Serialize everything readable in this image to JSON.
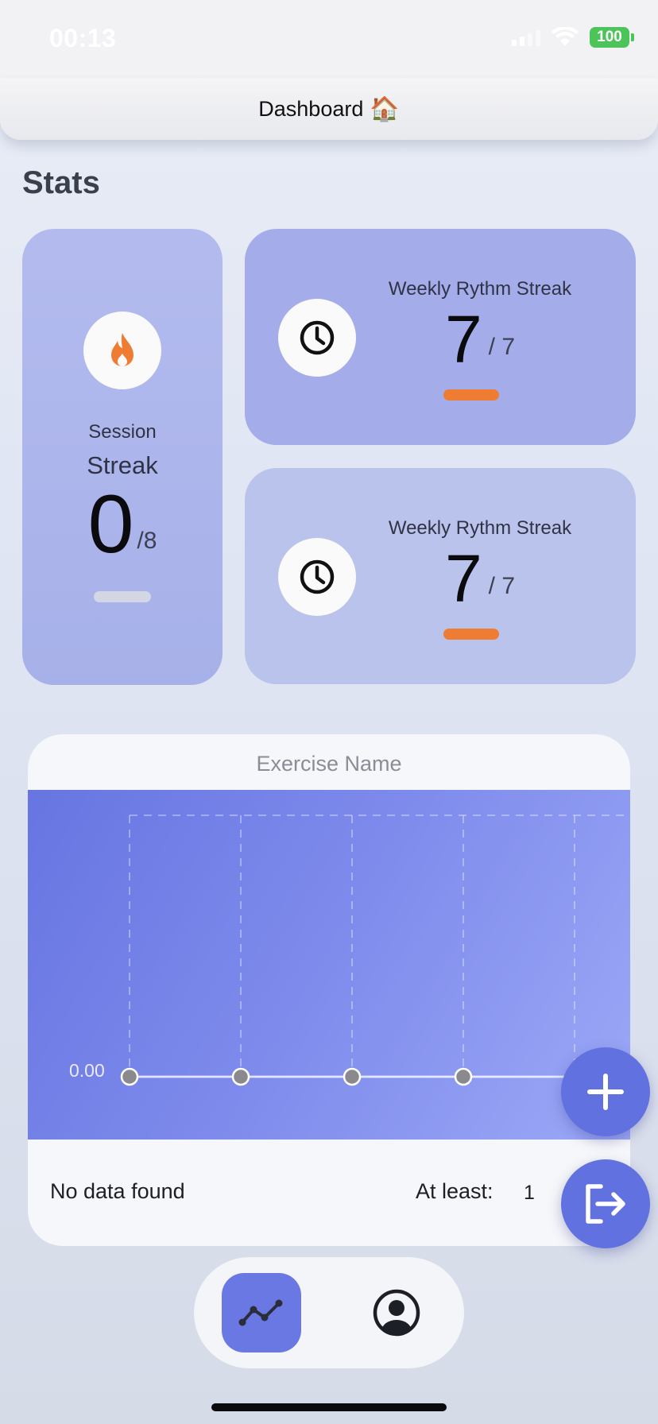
{
  "status_bar": {
    "time": "00:13",
    "battery": "100"
  },
  "header": {
    "title": "Dashboard",
    "emoji": "🏠"
  },
  "stats": {
    "title": "Stats",
    "session": {
      "label_top": "Session",
      "label_bottom": "Streak",
      "value": "0",
      "total": "/8",
      "progress": 0,
      "icon": "flame-icon"
    },
    "weekly_1": {
      "label": "Weekly Rythm Streak",
      "value": "7",
      "total": "/ 7",
      "progress": 1,
      "icon": "clock-icon"
    },
    "weekly_2": {
      "label": "Weekly Rythm Streak",
      "value": "7",
      "total": "/ 7",
      "progress": 1,
      "icon": "clock-icon"
    }
  },
  "chart": {
    "title": "Exercise Name",
    "no_data": "No data found",
    "at_least_label": "At least:",
    "at_least_value": "1"
  },
  "chart_data": {
    "type": "line",
    "title": "Exercise Name",
    "y_tick_labels": [
      "0.00"
    ],
    "values": [
      0,
      0,
      0,
      0,
      0
    ],
    "grid": true
  },
  "colors": {
    "accent": "#6271e0",
    "streak_bar": "#ee7c33",
    "flame": "#ee7c33"
  },
  "nav": {
    "items": [
      {
        "name": "stats-tab",
        "icon": "line-chart-icon",
        "active": true
      },
      {
        "name": "profile-tab",
        "icon": "user-icon",
        "active": false
      }
    ]
  },
  "fabs": {
    "add_icon": "plus-icon",
    "exit_icon": "logout-icon"
  }
}
